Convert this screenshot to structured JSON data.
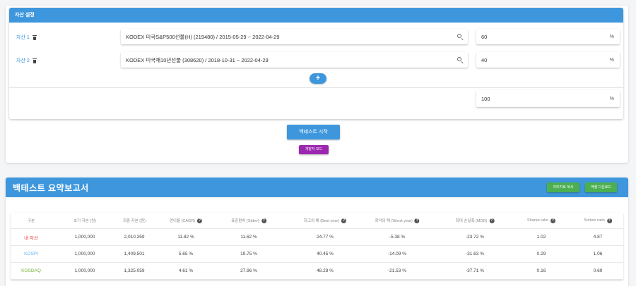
{
  "asset_settings": {
    "header": "자산 설정",
    "assets": [
      {
        "label": "자산 1",
        "value": "KODEX 미국S&P500선물(H) (219480) / 2015-05-29 ~ 2022-04-29",
        "weight": "60"
      },
      {
        "label": "자산 2",
        "value": "KODEX 미국채10년선물 (308620) / 2018-10-31 ~ 2022-04-29",
        "weight": "40"
      }
    ],
    "add_label": "+",
    "total_weight": "100",
    "percent_unit": "%"
  },
  "actions": {
    "backtest_start": "백테스트 시작",
    "developer_mode": "개발자 모드"
  },
  "report": {
    "title": "백테스트 요약보고서",
    "copy_image": "이미지로 복사",
    "excel_download": "엑셀 다운로드",
    "help_glyph": "?",
    "columns": [
      "구분",
      "초기 자본 (원)",
      "최종 자본 (원)",
      "연이율 (CAGR)",
      "표준편차 (Stdev)",
      "최고의 해 (Best year)",
      "최악의 해 (Worst year)",
      "최대 손실폭 (MDD)",
      "Sharpe ratio",
      "Sortino ratio"
    ],
    "rows": [
      {
        "name": "내 자산",
        "color": "#e53935",
        "cells": [
          "1,000,000",
          "2,010,359",
          "11.82 %",
          "11.62 %",
          "24.77 %",
          "-5.38 %",
          "-23.72 %",
          "1.02",
          "4.87"
        ]
      },
      {
        "name": "KOSPI",
        "color": "#64b5f6",
        "cells": [
          "1,000,000",
          "1,409,501",
          "5.65 %",
          "19.75 %",
          "40.45 %",
          "-14.09 %",
          "-31.63 %",
          "0.29",
          "1.06"
        ]
      },
      {
        "name": "KOSDAQ",
        "color": "#7cb342",
        "cells": [
          "1,000,000",
          "1,325,059",
          "4.61 %",
          "27.96 %",
          "48.28 %",
          "-21.53 %",
          "-37.71 %",
          "0.16",
          "0.69"
        ]
      }
    ]
  }
}
